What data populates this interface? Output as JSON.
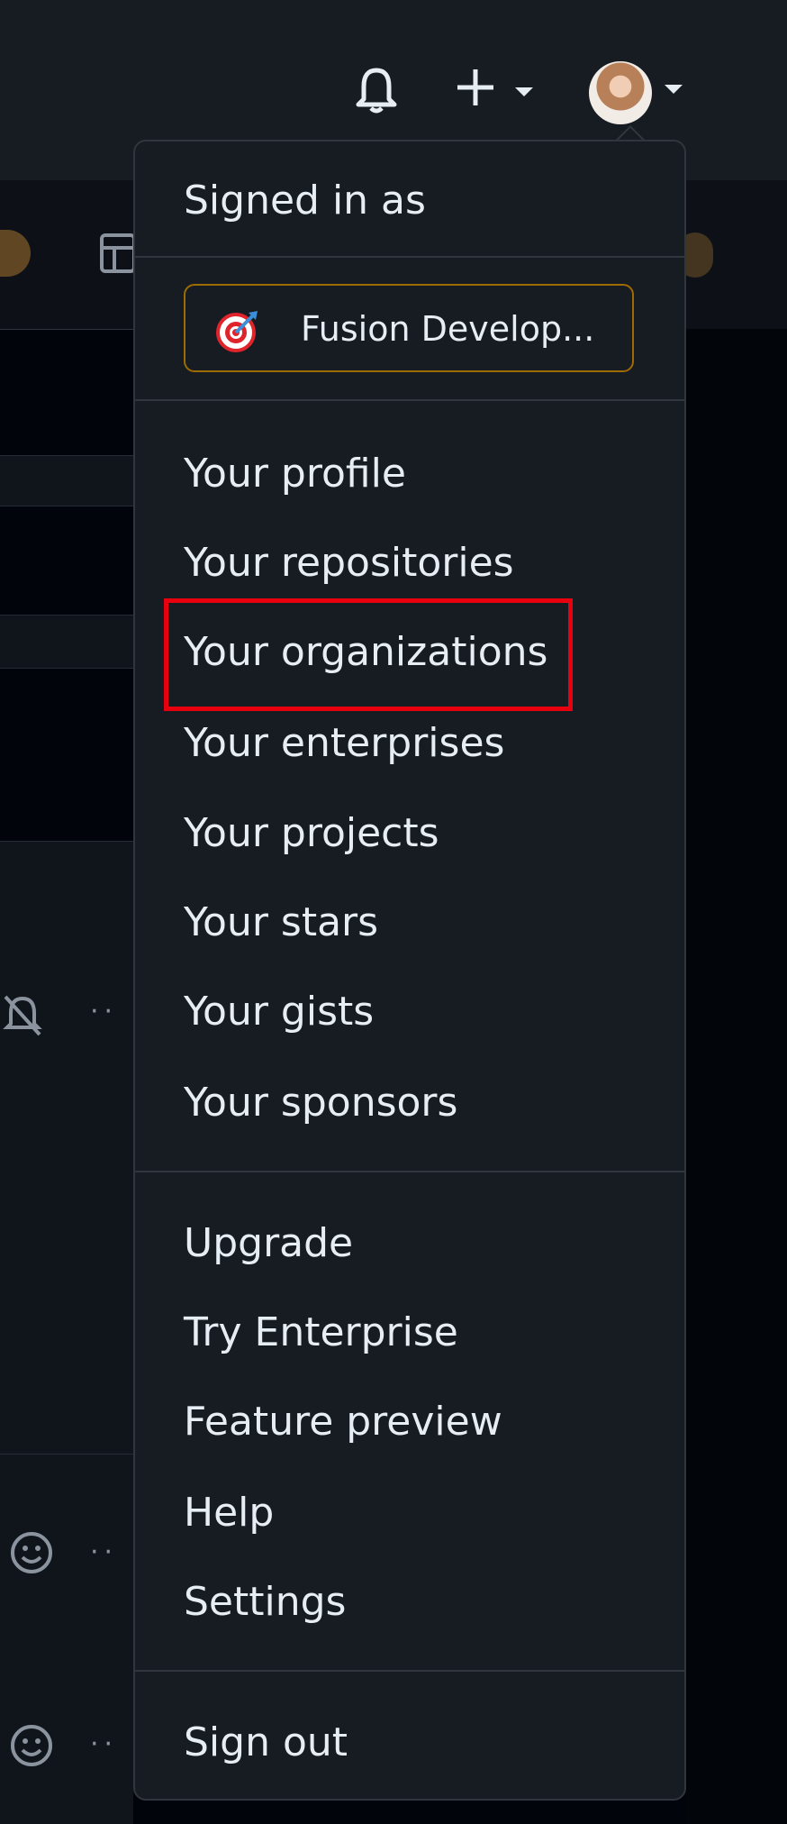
{
  "header": {
    "notifications_icon": "bell-icon",
    "create_icon": "plus-icon",
    "avatar_icon": "user-avatar"
  },
  "user_menu": {
    "signed_in_label": "Signed in as",
    "status": {
      "emoji": "direct-hit-target",
      "text": "Fusion Develop..."
    },
    "group_profile": [
      "Your profile",
      "Your repositories",
      "Your organizations",
      "Your enterprises",
      "Your projects",
      "Your stars",
      "Your gists",
      "Your sponsors"
    ],
    "group_account": [
      "Upgrade",
      "Try Enterprise",
      "Feature preview",
      "Help",
      "Settings"
    ],
    "sign_out": "Sign out"
  },
  "highlighted_item": "Your organizations",
  "colors": {
    "menu_bg": "#171b22",
    "border": "#30363d",
    "text": "#e6edf3",
    "highlight": "#e8000f",
    "status_border": "#9e6a03"
  }
}
